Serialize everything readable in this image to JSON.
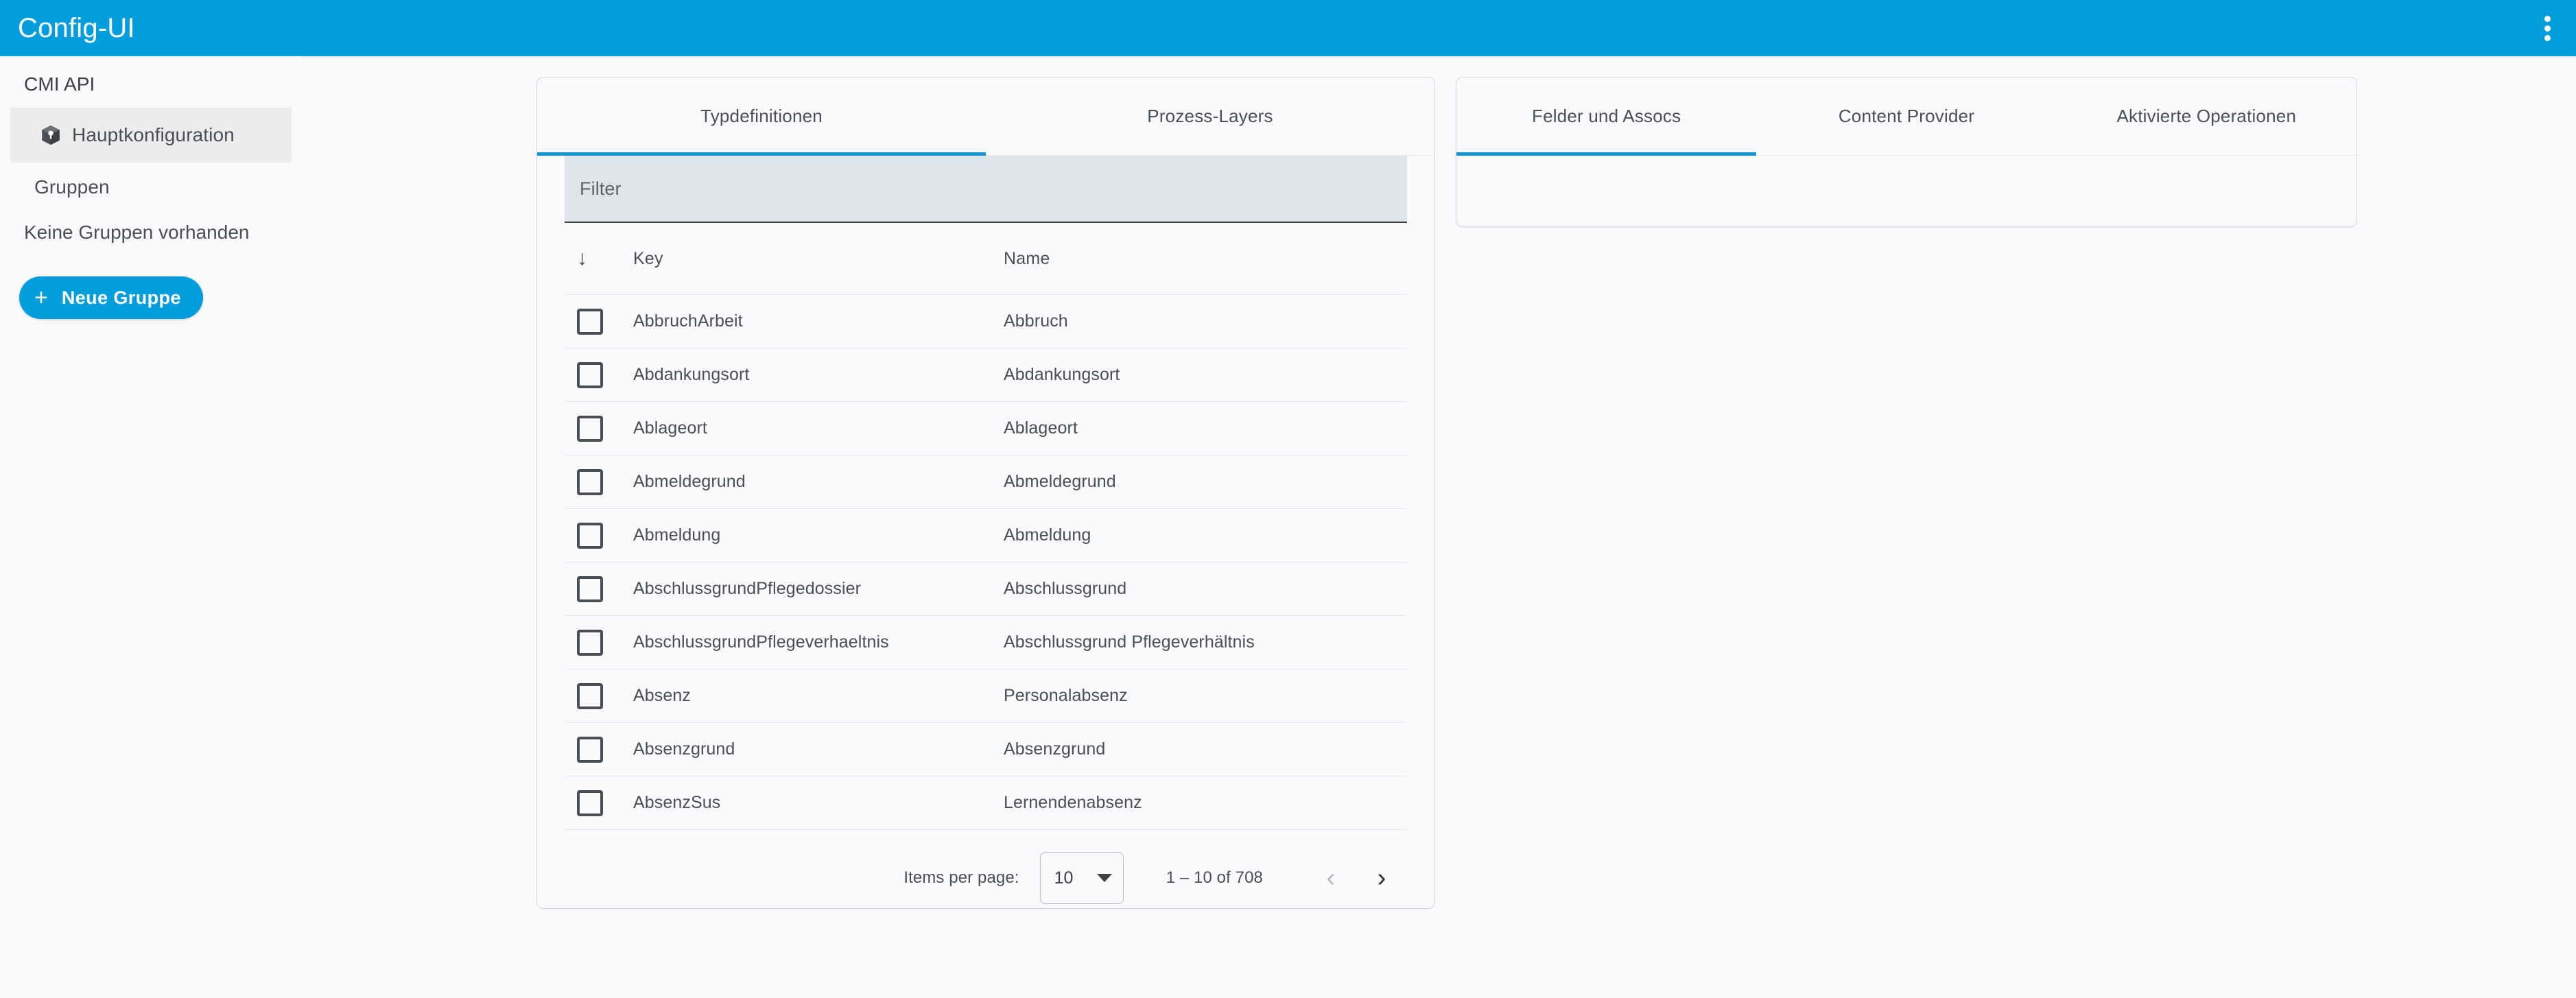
{
  "appbar": {
    "title": "Config-UI",
    "menu_icon": "more-vert-icon",
    "background": "#039ddd"
  },
  "sidebar": {
    "caption": "CMI API",
    "items": [
      {
        "label": "Hauptkonfiguration",
        "icon": "cube-icon",
        "active": true
      },
      {
        "label": "Gruppen",
        "icon": "",
        "active": false
      }
    ],
    "empty_state": "Keine Gruppen vorhanden",
    "new_group_button": {
      "plus": "+",
      "label": "Neue Gruppe",
      "color": "#029ddd"
    }
  },
  "left_panel": {
    "tabs": [
      {
        "label": "Typdefinitionen",
        "active": true
      },
      {
        "label": "Prozess-Layers",
        "active": false
      }
    ],
    "accent": "#1497d4",
    "filter": {
      "placeholder": "Filter",
      "value": ""
    },
    "table": {
      "sort_icon": "arrow-down-icon",
      "columns": [
        "",
        "Key",
        "Name"
      ],
      "rows": [
        {
          "key": "AbbruchArbeit",
          "name": "Abbruch",
          "checked": false
        },
        {
          "key": "Abdankungsort",
          "name": "Abdankungsort",
          "checked": false
        },
        {
          "key": "Ablageort",
          "name": "Ablageort",
          "checked": false
        },
        {
          "key": "Abmeldegrund",
          "name": "Abmeldegrund",
          "checked": false
        },
        {
          "key": "Abmeldung",
          "name": "Abmeldung",
          "checked": false
        },
        {
          "key": "AbschlussgrundPflegedossier",
          "name": "Abschlussgrund",
          "checked": false
        },
        {
          "key": "AbschlussgrundPflegeverhaeltnis",
          "name": "Abschlussgrund Pflegeverhältnis",
          "checked": false
        },
        {
          "key": "Absenz",
          "name": "Personalabsenz",
          "checked": false
        },
        {
          "key": "Absenzgrund",
          "name": "Absenzgrund",
          "checked": false
        },
        {
          "key": "AbsenzSus",
          "name": "Lernendenabsenz",
          "checked": false
        }
      ]
    },
    "paginator": {
      "items_per_page_label": "Items per page:",
      "page_size": "10",
      "range_label": "1 – 10 of 708",
      "prev_icon": "chevron-left-icon",
      "next_icon": "chevron-right-icon",
      "prev_disabled": true
    }
  },
  "right_panel": {
    "tabs": [
      {
        "label": "Felder und Assocs",
        "active": true
      },
      {
        "label": "Content Provider",
        "active": false
      },
      {
        "label": "Aktivierte Operationen",
        "active": false
      }
    ],
    "accent": "#1497d4"
  }
}
